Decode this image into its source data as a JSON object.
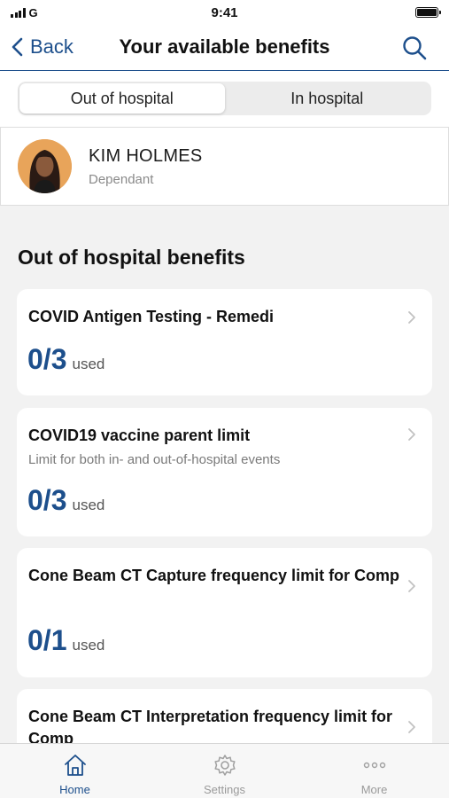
{
  "status_bar": {
    "carrier": "G",
    "time": "9:41"
  },
  "nav": {
    "back_label": "Back",
    "title": "Your available benefits"
  },
  "segments": [
    {
      "label": "Out of hospital",
      "active": true
    },
    {
      "label": "In hospital",
      "active": false
    }
  ],
  "member": {
    "name": "KIM HOLMES",
    "role": "Dependant"
  },
  "section_title": "Out of hospital benefits",
  "benefits": [
    {
      "title": "COVID Antigen Testing - Remedi",
      "subtitle": "",
      "usage": "0/3",
      "usage_label": "used"
    },
    {
      "title": "COVID19 vaccine parent limit",
      "subtitle": "Limit for both in- and out-of-hospital events",
      "usage": "0/3",
      "usage_label": "used"
    },
    {
      "title": "Cone Beam CT Capture frequency limit for Comp",
      "subtitle": "",
      "usage": "0/1",
      "usage_label": "used"
    },
    {
      "title": "Cone Beam CT Interpretation frequency limit for Comp",
      "subtitle": "",
      "usage": "",
      "usage_label": ""
    }
  ],
  "tabs": [
    {
      "label": "Home",
      "icon": "home-icon",
      "active": true
    },
    {
      "label": "Settings",
      "icon": "gear-icon",
      "active": false
    },
    {
      "label": "More",
      "icon": "more-icon",
      "active": false
    }
  ],
  "colors": {
    "accent": "#1d4f8c",
    "background": "#f2f2f2",
    "avatar_bg": "#e8a45a"
  }
}
